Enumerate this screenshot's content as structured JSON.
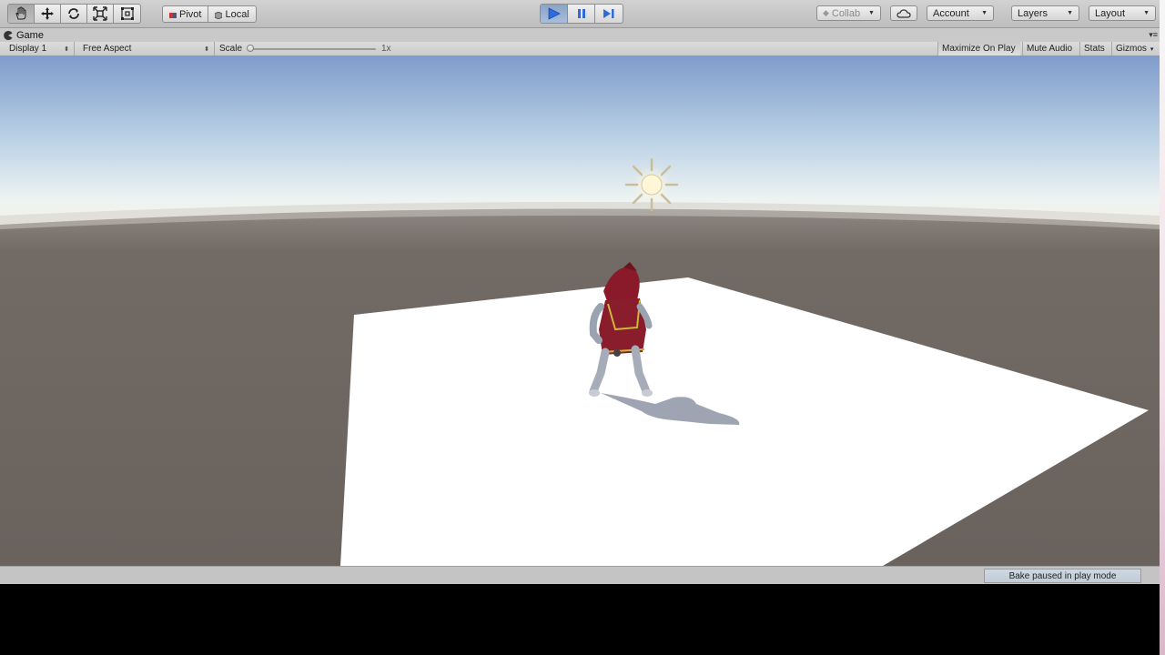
{
  "toolbar": {
    "tools": [
      {
        "name": "hand-tool",
        "icon": "hand-icon"
      },
      {
        "name": "move-tool",
        "icon": "move-arrows-icon"
      },
      {
        "name": "rotate-tool",
        "icon": "rotate-icon"
      },
      {
        "name": "scale-tool",
        "icon": "scale-icon"
      },
      {
        "name": "rect-tool",
        "icon": "rect-transform-icon"
      }
    ],
    "pivot_label": "Pivot",
    "local_label": "Local",
    "play_controls": [
      "play",
      "pause",
      "step"
    ],
    "collab_label": "Collab",
    "account_label": "Account",
    "layers_label": "Layers",
    "layout_label": "Layout"
  },
  "game_tab": {
    "title": "Game"
  },
  "game_toolbar": {
    "display": "Display 1",
    "aspect": "Free Aspect",
    "scale_label": "Scale",
    "scale_value": "1x",
    "scale_fraction": 0.0,
    "maximize_on_play": "Maximize On Play",
    "mute_audio": "Mute Audio",
    "stats": "Stats",
    "gizmos": "Gizmos"
  },
  "status": {
    "message": "Bake paused in play mode"
  },
  "colors": {
    "play_active": "#3a6fd8",
    "sky_top": "#7f9ccb",
    "ground": "#6e6661"
  }
}
